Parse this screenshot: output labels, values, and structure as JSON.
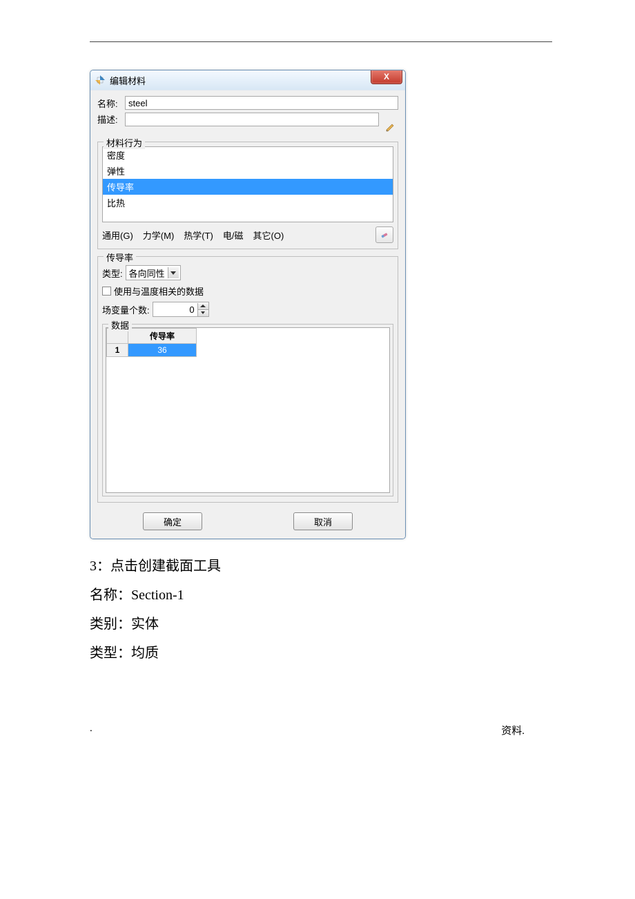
{
  "dialog": {
    "title": "编辑材料",
    "close_glyph": "X",
    "name_label": "名称:",
    "name_value": "steel",
    "desc_label": "描述:",
    "desc_value": "",
    "behavior_group_legend": "材料行为",
    "behaviors": [
      "密度",
      "弹性",
      "传导率",
      "比热"
    ],
    "behavior_selected_index": 2,
    "menus": {
      "general": "通用(G)",
      "mechanics": "力学(M)",
      "thermal": "热学(T)",
      "emag": "电/磁",
      "other": "其它(O)"
    },
    "conduct_group_legend": "传导率",
    "type_label": "类型:",
    "type_value": "各向同性",
    "temp_checkbox_label": "使用与温度相关的数据",
    "temp_checked": false,
    "field_var_label": "场变量个数:",
    "field_var_value": "0",
    "data_group_legend": "数据",
    "data_table": {
      "col_header": "传导率",
      "rows": [
        {
          "index": "1",
          "value": "36"
        }
      ]
    },
    "ok_label": "确定",
    "cancel_label": "取消"
  },
  "doc": {
    "line1": "3：点击创建截面工具",
    "line2": "名称：Section-1",
    "line3": "类别：实体",
    "line4": "类型：均质"
  },
  "footer": {
    "left": ".",
    "right": "资料."
  }
}
